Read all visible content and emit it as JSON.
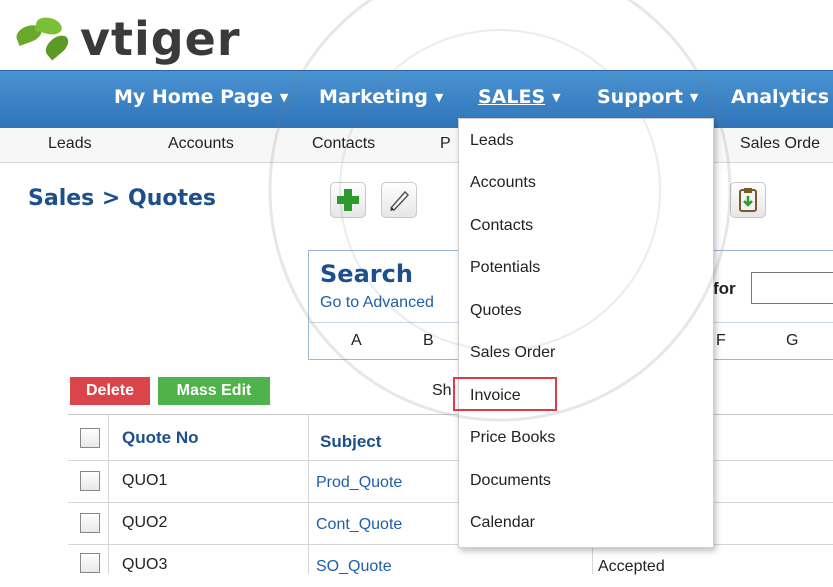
{
  "app": {
    "logo_text": "vtiger",
    "brand_color": "#2f74b8"
  },
  "topnav": {
    "items": [
      {
        "label": "My Home Page",
        "has_caret": true
      },
      {
        "label": "Marketing",
        "has_caret": true
      },
      {
        "label": "SALES",
        "has_caret": true,
        "active": true
      },
      {
        "label": "Support",
        "has_caret": true
      },
      {
        "label": "Analytics",
        "has_caret": false
      }
    ]
  },
  "subnav": {
    "items": [
      "Leads",
      "Accounts",
      "Contacts",
      "P",
      "Sales Orde"
    ]
  },
  "breadcrumb": "Sales > Quotes",
  "toolbar": {
    "icons": [
      "add-icon",
      "edit-icon",
      "clipboard-icon"
    ]
  },
  "search": {
    "title": "Search",
    "advanced_link": "Go to Advanced",
    "for_label": "for",
    "input_value": "",
    "alphabet": [
      "A",
      "B",
      "F",
      "G"
    ]
  },
  "actions": {
    "delete_label": "Delete",
    "mass_edit_label": "Mass Edit",
    "show_text": "Sh"
  },
  "table": {
    "headers": [
      "Quote No",
      "Subject"
    ],
    "rows": [
      {
        "quote_no": "QUO1",
        "subject": "Prod_Quote",
        "stage": ""
      },
      {
        "quote_no": "QUO2",
        "subject": "Cont_Quote",
        "stage": ""
      },
      {
        "quote_no": "QUO3",
        "subject": "SO_Quote",
        "stage": "Accepted"
      }
    ]
  },
  "sales_menu": {
    "items": [
      "Leads",
      "Accounts",
      "Contacts",
      "Potentials",
      "Quotes",
      "Sales Order",
      "Invoice",
      "Price Books",
      "Documents",
      "Calendar"
    ],
    "highlighted": "Invoice",
    "highlight_color": "#e33a4a"
  }
}
